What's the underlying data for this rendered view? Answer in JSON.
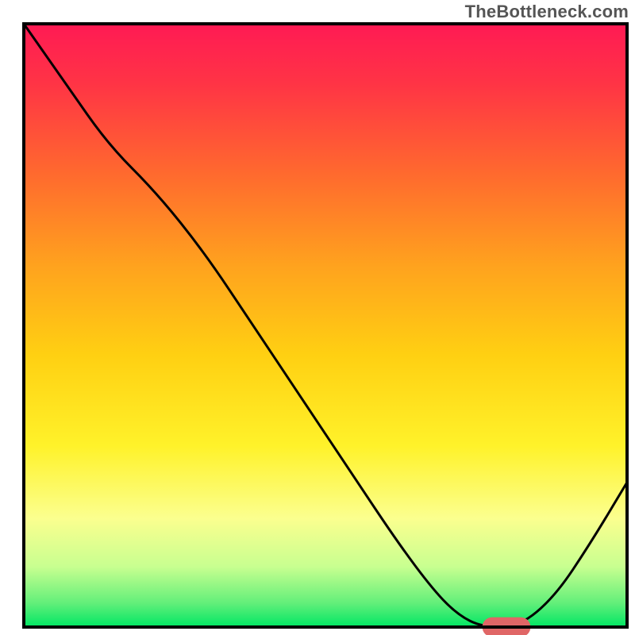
{
  "watermark": "TheBottleneck.com",
  "chart_data": {
    "type": "line",
    "title": "",
    "xlabel": "",
    "ylabel": "",
    "xlim": [
      0,
      100
    ],
    "ylim": [
      0,
      100
    ],
    "grid": false,
    "legend": false,
    "gradient_stops": [
      {
        "offset": 0,
        "color": "#ff1a54"
      },
      {
        "offset": 10,
        "color": "#ff3445"
      },
      {
        "offset": 25,
        "color": "#ff6a2e"
      },
      {
        "offset": 40,
        "color": "#ffa21e"
      },
      {
        "offset": 55,
        "color": "#ffd012"
      },
      {
        "offset": 70,
        "color": "#fff22a"
      },
      {
        "offset": 82,
        "color": "#fbff8f"
      },
      {
        "offset": 90,
        "color": "#c8ff90"
      },
      {
        "offset": 96,
        "color": "#63ef7a"
      },
      {
        "offset": 100,
        "color": "#00e664"
      }
    ],
    "series": [
      {
        "name": "bottleneck-curve",
        "color": "#000000",
        "x": [
          0,
          7,
          14,
          22,
          30,
          38,
          46,
          54,
          62,
          68,
          72,
          76,
          82,
          88,
          94,
          100
        ],
        "y": [
          100,
          90,
          80,
          72,
          62,
          50,
          38,
          26,
          14,
          6,
          2,
          0,
          0,
          5,
          14,
          24
        ]
      }
    ],
    "marker": {
      "name": "optimal-range",
      "color": "#e06666",
      "x_start": 76,
      "x_end": 84,
      "y": 0,
      "thickness": 2.2
    },
    "frame_color": "#000000",
    "frame_width": 4
  }
}
